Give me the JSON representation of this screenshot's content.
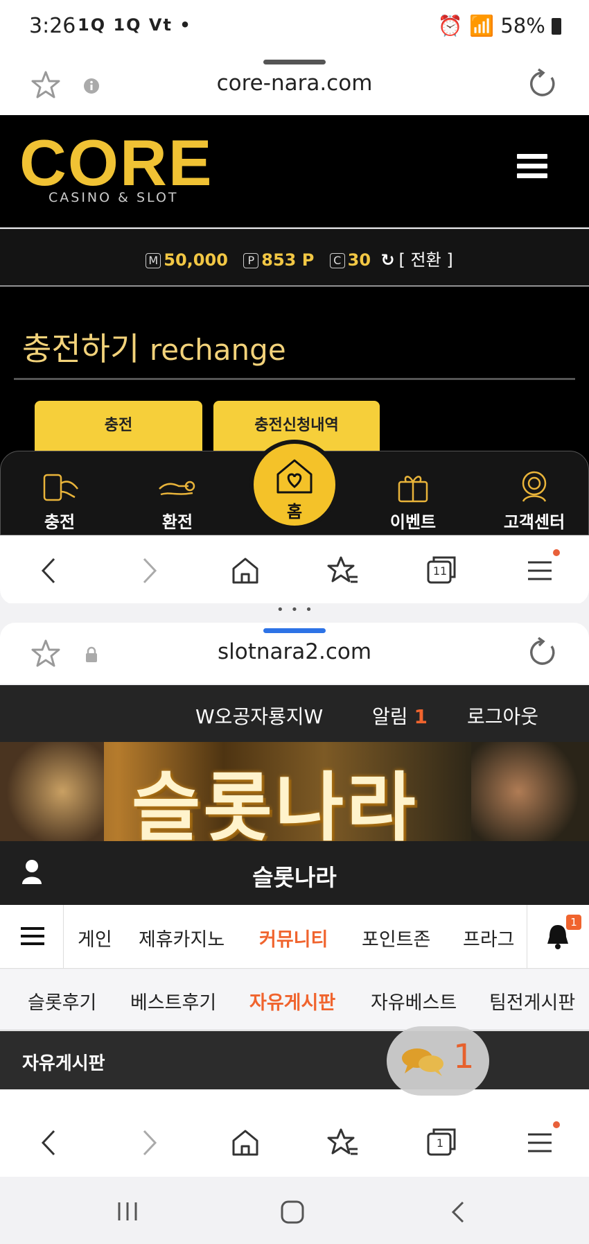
{
  "status_bar": {
    "time": "3:26",
    "indicators": "1Q 1Q Vt •",
    "right": "58%"
  },
  "top_window": {
    "url": "core-nara.com",
    "logo_main": "CORE",
    "logo_sub": "CASINO & SLOT",
    "balance": {
      "m_label": "M",
      "m_value": "50,000",
      "p_label": "P",
      "p_value": "853 P",
      "c_label": "C",
      "c_value": "30",
      "toggle": "[ 전환 ]"
    },
    "section_title_ko": "충전하기",
    "section_title_en": "rechange",
    "buttons": [
      "충전",
      "충전신청내역"
    ],
    "bottom_nav": [
      "충전",
      "환전",
      "홈",
      "이벤트",
      "고객센터"
    ]
  },
  "browser_nav": {
    "tabs_count_top": "11",
    "tabs_count_bottom": "1"
  },
  "bottom_window": {
    "url": "slotnara2.com",
    "user_name": "W오공자룡지W",
    "alert_label": "알림",
    "alert_count": "1",
    "logout": "로그아웃",
    "banner_text": "슬롯나라",
    "site_title": "슬롯나라",
    "main_nav": [
      "게인",
      "제휴카지노",
      "커뮤니티",
      "포인트존",
      "프라그"
    ],
    "bell_badge": "1",
    "sub_nav": [
      "슬롯후기",
      "베스트후기",
      "자유게시판",
      "자유베스트",
      "팀전게시판"
    ],
    "board_title": "자유게시판",
    "chat_count": "1"
  },
  "colors": {
    "gold": "#f2c744",
    "accent_orange": "#e8603a",
    "dark": "#000000"
  }
}
